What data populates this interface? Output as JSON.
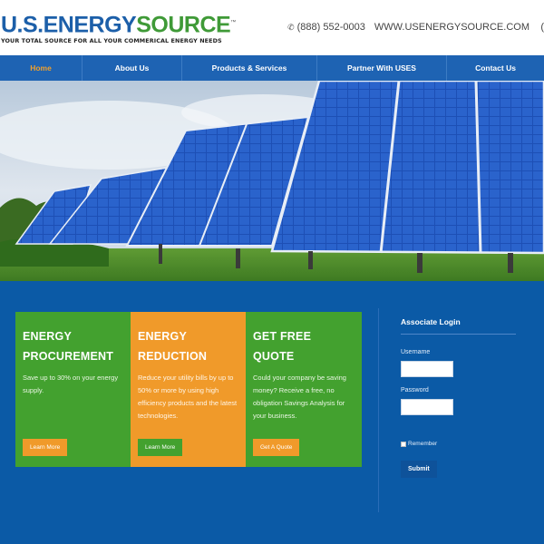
{
  "header": {
    "logo": {
      "part1": "U.S.",
      "part2": "ENERGY",
      "part3": "SOURCE",
      "trademark": "™",
      "tagline": "YOUR TOTAL SOURCE FOR ALL YOUR COMMERICAL ENERGY NEEDS"
    },
    "phone": "(888) 552-0003",
    "website": "WWW.USENERGYSOURCE.COM",
    "edge_text": "("
  },
  "nav": {
    "items": [
      {
        "label": "Home",
        "active": true
      },
      {
        "label": "About Us",
        "active": false
      },
      {
        "label": "Products & Services",
        "active": false
      },
      {
        "label": "Partner With USES",
        "active": false
      },
      {
        "label": "Contact Us",
        "active": false
      }
    ]
  },
  "cards": [
    {
      "title_line1": "ENERGY",
      "title_line2": "PROCUREMENT",
      "text": "Save up to 30% on your energy supply.",
      "button": "Learn More"
    },
    {
      "title_line1": "ENERGY",
      "title_line2": "REDUCTION",
      "text": "Reduce your utility bills by up to 50% or more by using high efficiency products and the latest technologies.",
      "button": "Learn More"
    },
    {
      "title_line1": "GET FREE",
      "title_line2": "QUOTE",
      "text": "Could your company be saving money? Receive a free, no obligation Savings Analysis for your business.",
      "button": "Get A Quote"
    }
  ],
  "login": {
    "title": "Associate Login",
    "username_label": "Username",
    "username_value": "",
    "password_label": "Password",
    "password_value": "",
    "remember_label": "Remember",
    "submit": "Submit"
  },
  "colors": {
    "brand_blue": "#1c5fa9",
    "brand_green": "#3f9a37",
    "nav_bg": "#1e63b3",
    "active_nav": "#f0a02c",
    "page_bg": "#0b5aa6",
    "card_green": "#43a12f",
    "card_orange": "#f09a2a"
  }
}
